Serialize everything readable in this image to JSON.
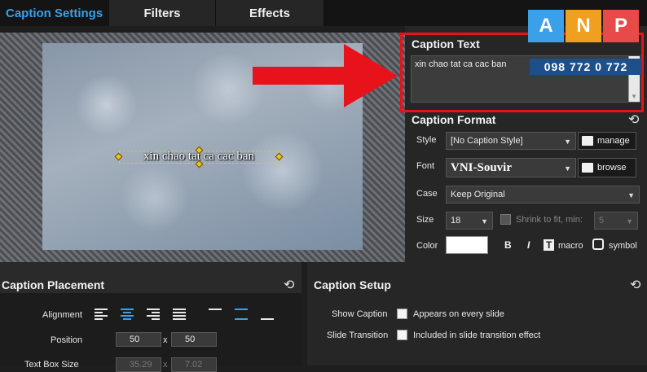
{
  "tabs": [
    {
      "label": "Caption Settings"
    },
    {
      "label": "Filters"
    },
    {
      "label": "Effects"
    }
  ],
  "preview": {
    "caption": "xin chao tat ca cac ban"
  },
  "caption_text": {
    "title": "Caption Text",
    "value": "xin chao tat ca cac ban"
  },
  "caption_format": {
    "title": "Caption Format",
    "style_label": "Style",
    "style_value": "[No Caption Style]",
    "manage_label": "manage",
    "font_label": "Font",
    "font_value": "VNI-Souvir",
    "browse_label": "browse",
    "case_label": "Case",
    "case_value": "Keep Original",
    "size_label": "Size",
    "size_value": "18",
    "shrink_label": "Shrink to fit, min:",
    "shrink_value": "5",
    "color_label": "Color",
    "color_value": "#ffffff",
    "bold": "B",
    "italic": "I",
    "t_glyph": "T",
    "macro_label": "macro",
    "symbol_label": "symbol"
  },
  "placement": {
    "title": "Caption Placement",
    "alignment_label": "Alignment",
    "position_label": "Position",
    "pos_x": "50",
    "pos_y": "50",
    "x_sep": "x",
    "textbox_label": "Text Box Size",
    "tb_w": "35.29",
    "tb_h": "7.02"
  },
  "setup": {
    "title": "Caption Setup",
    "show_label": "Show Caption",
    "show_text": "Appears on every slide",
    "transition_label": "Slide Transition",
    "transition_text": "Included in slide transition effect"
  },
  "logo": {
    "letters": [
      "A",
      "N",
      "P"
    ],
    "phone": "098 772 0 772",
    "colors": [
      "#3aa0e8",
      "#f0a020",
      "#e84a4a"
    ]
  },
  "icons": [
    "reset-icon",
    "list-icon",
    "folder-icon",
    "chevron-down-icon",
    "arrow-icon"
  ]
}
